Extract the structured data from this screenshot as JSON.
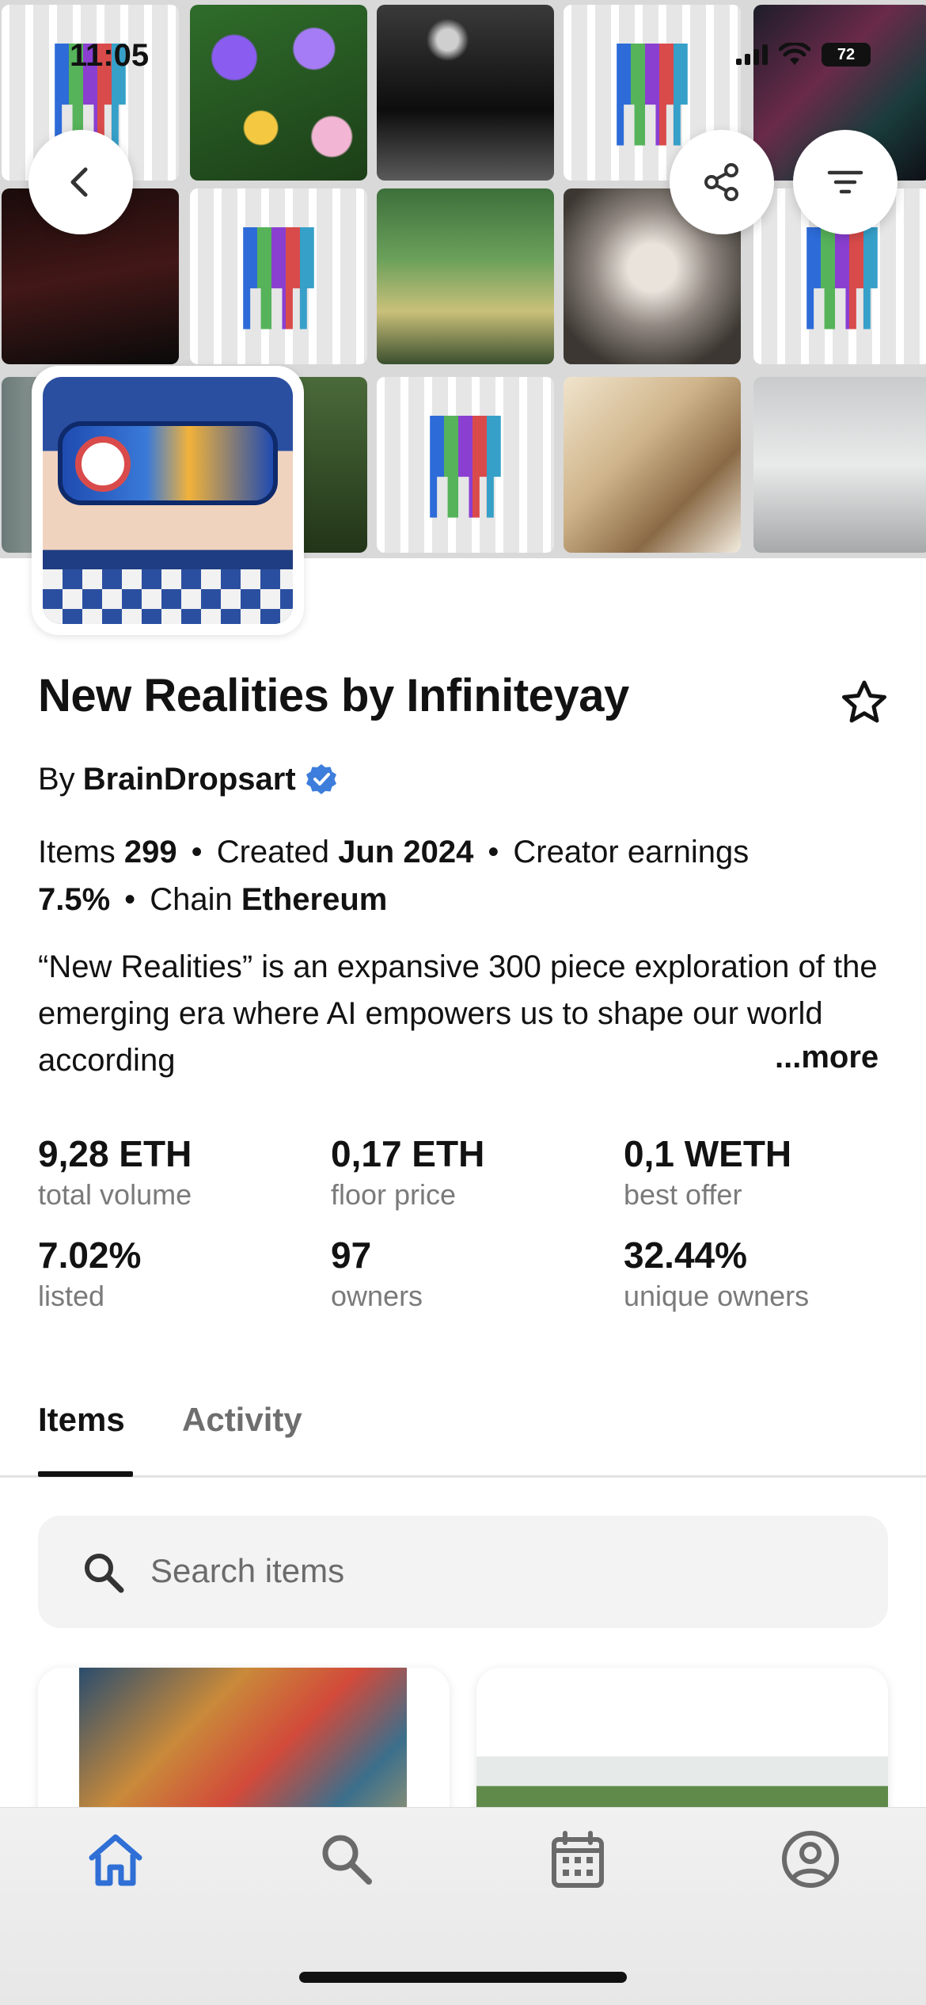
{
  "status_bar": {
    "time": "11:05",
    "battery": "72"
  },
  "collection": {
    "title": "New Realities by Infiniteyay",
    "by_prefix": "By",
    "creator": "BrainDropsart",
    "meta": {
      "items_label": "Items",
      "items_value": "299",
      "created_label": "Created",
      "created_value": "Jun 2024",
      "earnings_label": "Creator earnings",
      "earnings_value": "7.5%",
      "chain_label": "Chain",
      "chain_value": "Ethereum"
    },
    "description": "“New Realities” is an expansive 300 piece exploration of the emerging era where AI empowers us to shape our world according",
    "more_label": "...more"
  },
  "stats": [
    {
      "value": "9,28 ETH",
      "label": "total volume"
    },
    {
      "value": "0,17 ETH",
      "label": "floor price"
    },
    {
      "value": "0,1 WETH",
      "label": "best offer"
    },
    {
      "value": "7.02%",
      "label": "listed"
    },
    {
      "value": "97",
      "label": "owners"
    },
    {
      "value": "32.44%",
      "label": "unique owners"
    }
  ],
  "tabs": [
    {
      "label": "Items",
      "active": true
    },
    {
      "label": "Activity",
      "active": false
    }
  ],
  "search": {
    "placeholder": "Search items"
  },
  "icons": {
    "back": "chevron-left-icon",
    "share": "share-icon",
    "filter": "filter-icon",
    "favorite": "star-icon",
    "verified": "verified-badge-icon",
    "search": "search-icon",
    "nav": [
      "home-icon",
      "search-icon",
      "calendar-icon",
      "profile-icon"
    ]
  },
  "colors": {
    "accent": "#2f6fd6",
    "verified": "#3d7ddb",
    "text": "#121212",
    "muted": "#7a7a7a"
  }
}
